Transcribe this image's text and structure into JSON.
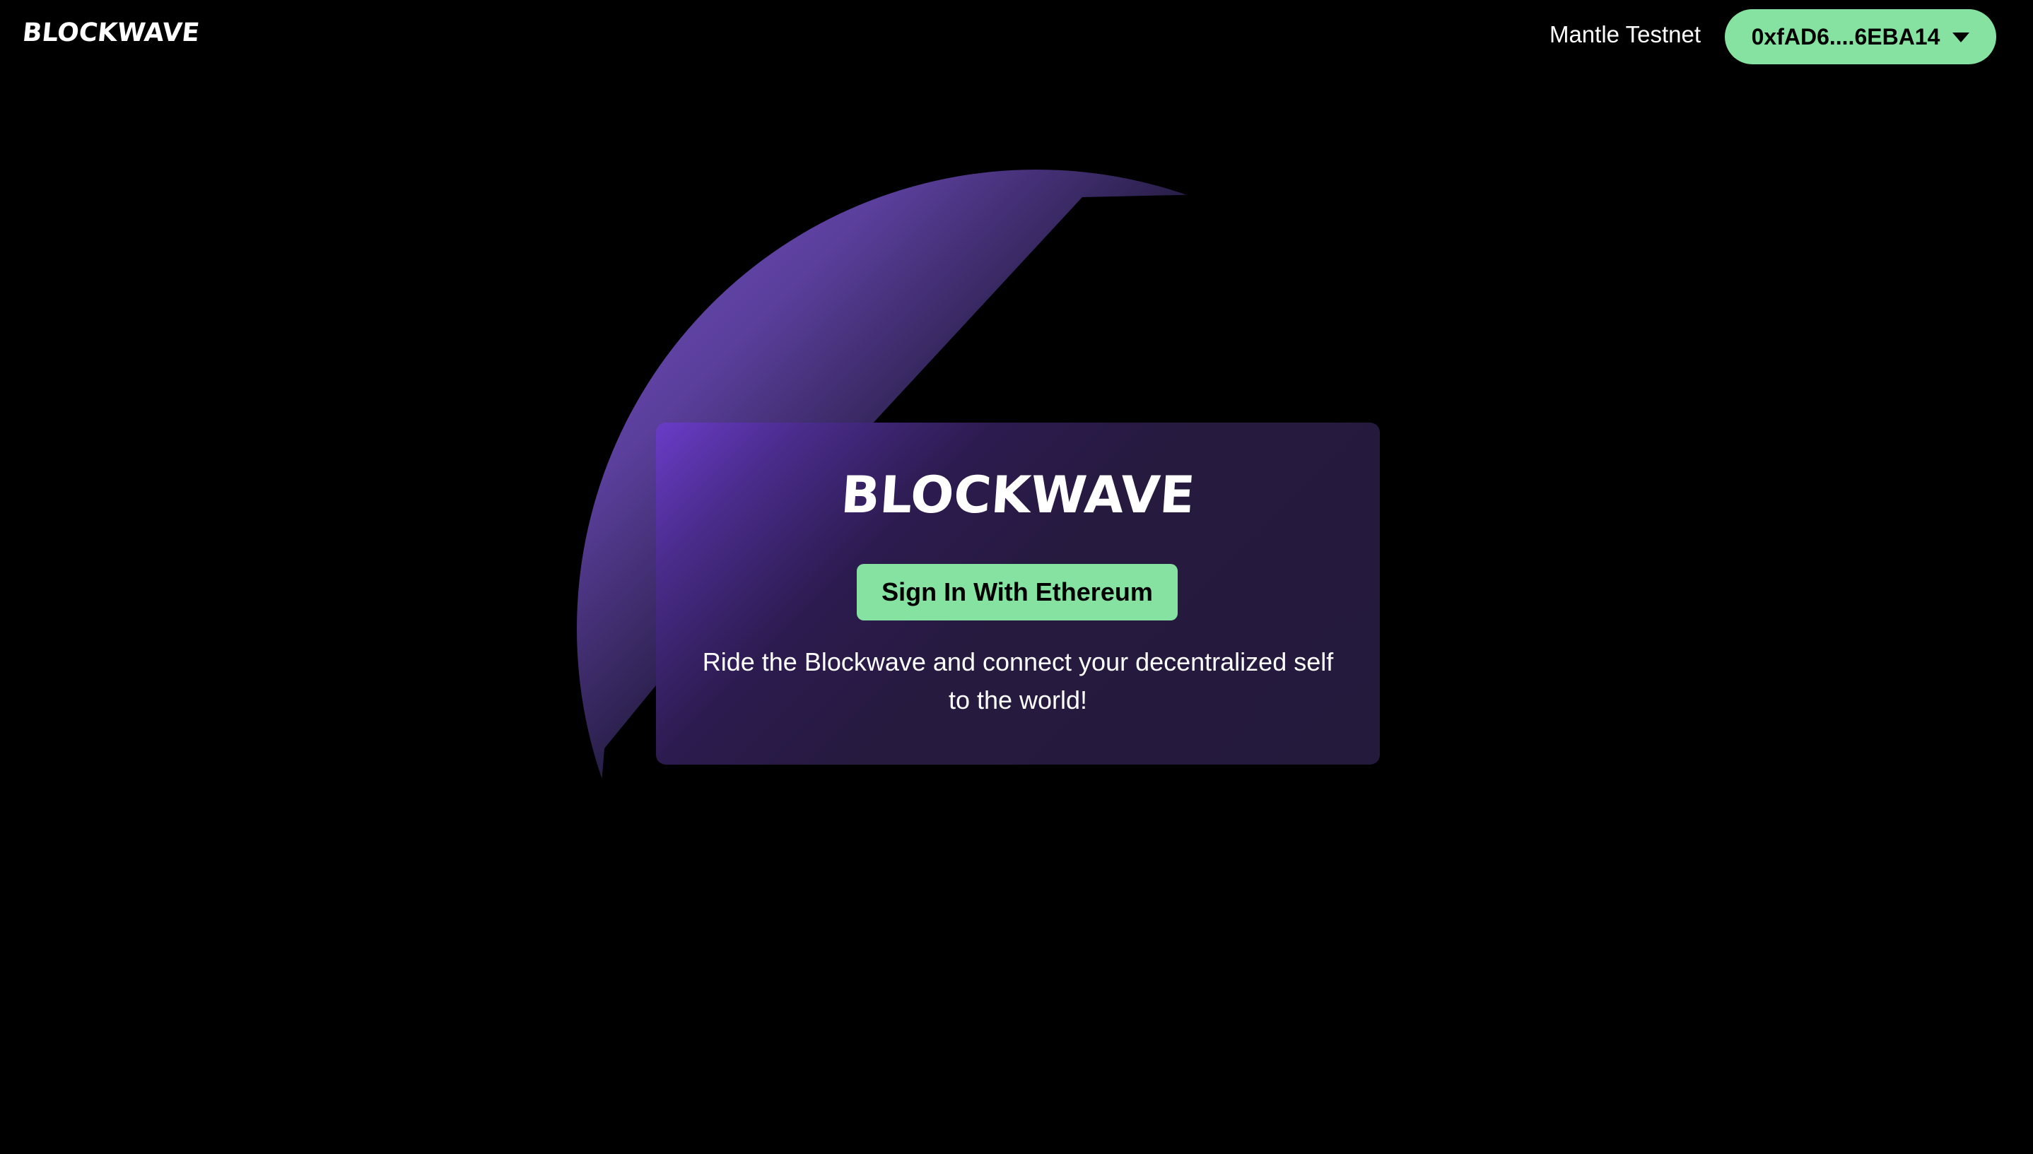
{
  "header": {
    "logo_text": "BLOCKWAVE",
    "network_label": "Mantle Testnet",
    "wallet_address": "0xfAD6....6EBA14"
  },
  "card": {
    "title": "BLOCKWAVE",
    "signin_label": "Sign In With Ethereum",
    "tagline": "Ride the Blockwave and connect your decentralized self to the world!"
  },
  "colors": {
    "background": "#000000",
    "accent_green": "#86e2a0",
    "card_purple": "#261a3f",
    "orb_purple": "#6f4fc0"
  },
  "icons": {
    "wallet_dropdown": "caret-down-icon"
  }
}
